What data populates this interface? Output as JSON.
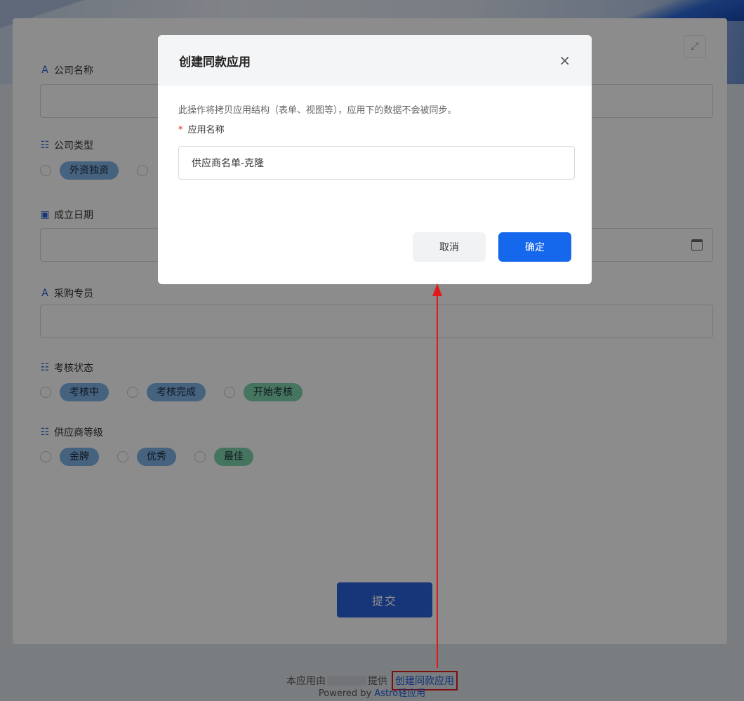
{
  "form": {
    "fields": [
      {
        "icon": "text-icon",
        "label": "公司名称"
      },
      {
        "icon": "radio-list-icon",
        "label": "公司类型",
        "options": [
          "外资独资"
        ]
      },
      {
        "icon": "calendar-icon",
        "label": "成立日期"
      },
      {
        "icon": "text-icon",
        "label": "采购专员"
      },
      {
        "icon": "radio-list-icon",
        "label": "考核状态",
        "options": [
          "考核中",
          "考核完成",
          "开始考核"
        ]
      },
      {
        "icon": "radio-list-icon",
        "label": "供应商等级",
        "options": [
          "金牌",
          "优秀",
          "最佳"
        ]
      }
    ],
    "submit_label": "提交"
  },
  "footer": {
    "provided_prefix": "本应用由",
    "provided_suffix": "提供",
    "clone_link": "创建同款应用",
    "powered_by": "Powered by",
    "brand": "Astro轻应用"
  },
  "modal": {
    "title": "创建同款应用",
    "close_glyph": "×",
    "description": "此操作将拷贝应用结构（表单、视图等），应用下的数据不会被同步。",
    "required_mark": "*",
    "name_label": "应用名称",
    "name_value": "供应商名单-克隆",
    "cancel_label": "取消",
    "ok_label": "确定"
  },
  "colors": {
    "primary": "#1567ec",
    "annotation_red": "#e01b1b",
    "pill_blue": "#7fb3e8",
    "pill_green": "#7fd3ad"
  }
}
